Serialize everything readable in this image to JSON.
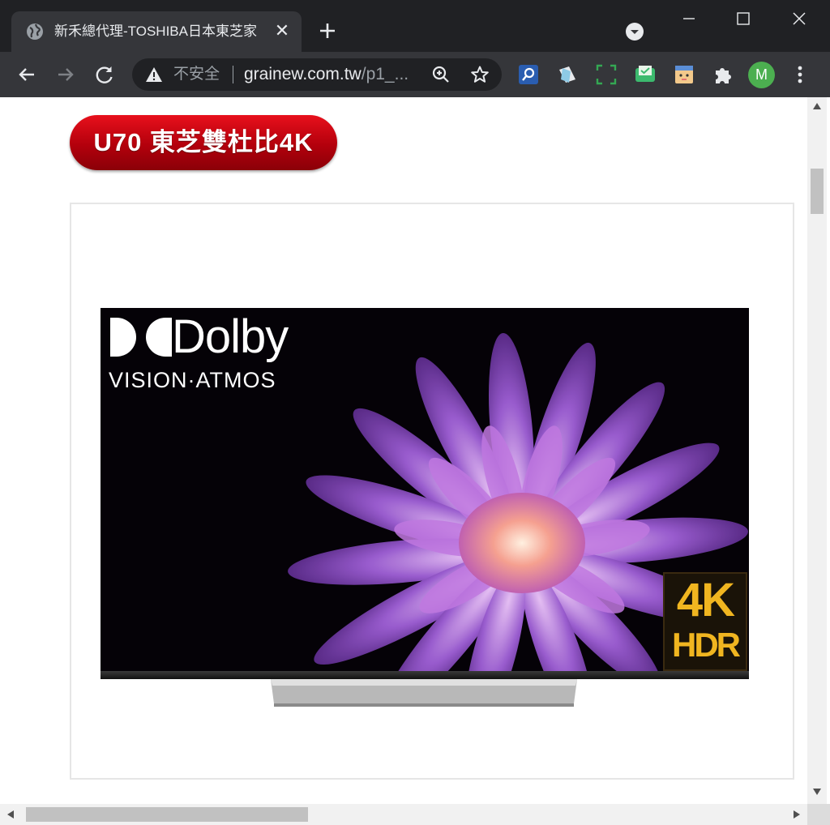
{
  "browser": {
    "tab": {
      "title": "新禾總代理-TOSHIBA日本東芝家",
      "close_glyph": "✕"
    },
    "omnibox": {
      "security_label": "不安全",
      "url_host": "grainew.com.tw",
      "url_path": "/p1_..."
    },
    "profile_initial": "M",
    "icons": [
      "globe-icon",
      "new-tab-icon",
      "tab-search-icon",
      "minimize-icon",
      "maximize-icon",
      "close-window-icon",
      "back-icon",
      "forward-icon",
      "reload-icon",
      "warning-icon",
      "zoom-icon",
      "star-icon",
      "extension-search-icon",
      "extension-note-icon",
      "extension-screenshot-icon",
      "extension-mail-icon",
      "extension-face-icon",
      "extensions-puzzle-icon",
      "menu-icon"
    ],
    "colors": {
      "frame": "#202124",
      "toolbar": "#35363a",
      "avatar": "#4caf50"
    }
  },
  "page": {
    "heading_pill": "U70 東芝雙杜比4K",
    "product_image": {
      "logo_text": "Dolby",
      "logo_subtext": "VISION·ATMOS",
      "badge_line1": "4K",
      "badge_line2": "HDR"
    },
    "colors": {
      "pill_red": "#c8000f",
      "badge_gold": "#f0b520"
    }
  }
}
